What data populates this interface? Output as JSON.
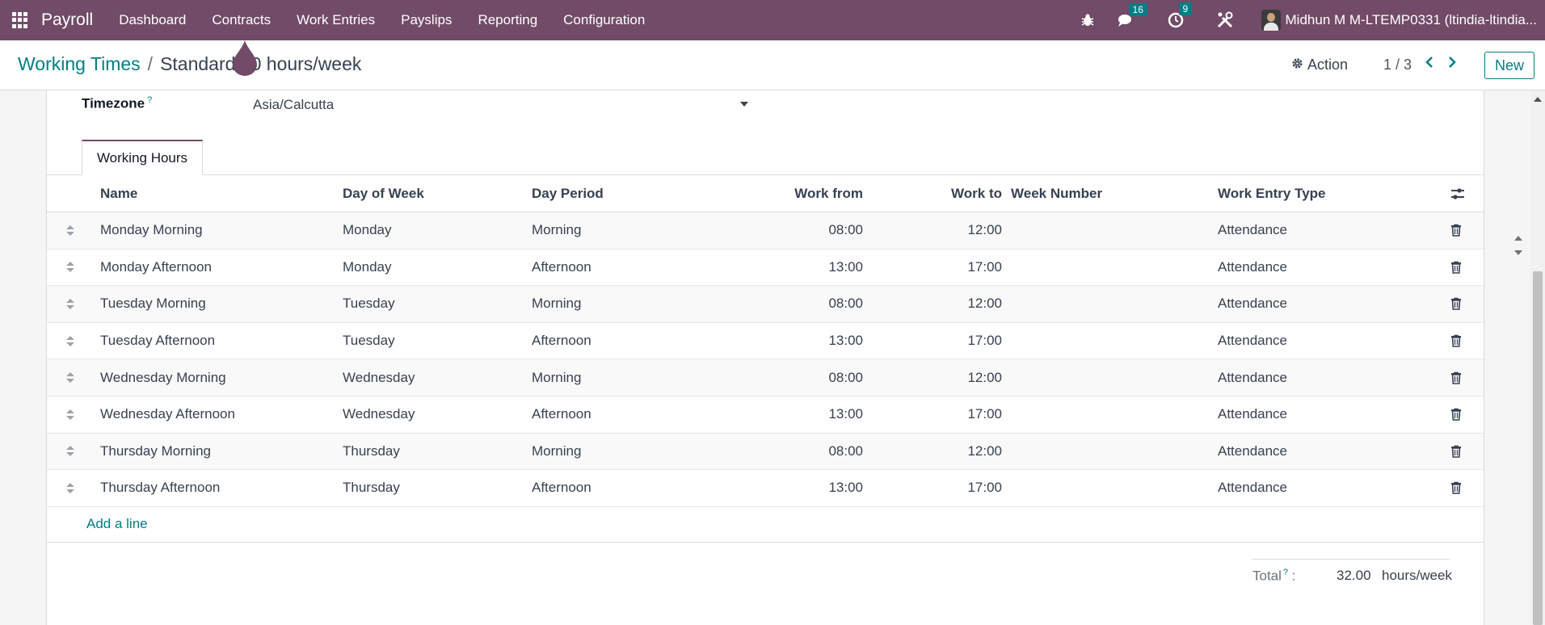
{
  "navbar": {
    "brand": "Payroll",
    "menu": [
      "Dashboard",
      "Contracts",
      "Work Entries",
      "Payslips",
      "Reporting",
      "Configuration"
    ],
    "messages_count": "16",
    "activities_count": "9",
    "user": "Midhun M M-LTEMP0331 (ltindia-ltindia..."
  },
  "breadcrumb": {
    "parent": "Working Times",
    "separator": "/",
    "current": "Standard 40 hours/week"
  },
  "control": {
    "action_label": "Action",
    "pager": "1 / 3",
    "new_label": "New"
  },
  "form": {
    "timezone_label": "Timezone",
    "help_mark": "?",
    "timezone_value": "Asia/Calcutta"
  },
  "tab": {
    "label": "Working Hours"
  },
  "table": {
    "headers": {
      "name": "Name",
      "day": "Day of Week",
      "period": "Day Period",
      "from": "Work from",
      "to": "Work to",
      "week": "Week Number",
      "type": "Work Entry Type"
    },
    "rows": [
      {
        "name": "Monday Morning",
        "day": "Monday",
        "period": "Morning",
        "from": "08:00",
        "to": "12:00",
        "week": "",
        "type": "Attendance"
      },
      {
        "name": "Monday Afternoon",
        "day": "Monday",
        "period": "Afternoon",
        "from": "13:00",
        "to": "17:00",
        "week": "",
        "type": "Attendance"
      },
      {
        "name": "Tuesday Morning",
        "day": "Tuesday",
        "period": "Morning",
        "from": "08:00",
        "to": "12:00",
        "week": "",
        "type": "Attendance"
      },
      {
        "name": "Tuesday Afternoon",
        "day": "Tuesday",
        "period": "Afternoon",
        "from": "13:00",
        "to": "17:00",
        "week": "",
        "type": "Attendance"
      },
      {
        "name": "Wednesday Morning",
        "day": "Wednesday",
        "period": "Morning",
        "from": "08:00",
        "to": "12:00",
        "week": "",
        "type": "Attendance"
      },
      {
        "name": "Wednesday Afternoon",
        "day": "Wednesday",
        "period": "Afternoon",
        "from": "13:00",
        "to": "17:00",
        "week": "",
        "type": "Attendance"
      },
      {
        "name": "Thursday Morning",
        "day": "Thursday",
        "period": "Morning",
        "from": "08:00",
        "to": "12:00",
        "week": "",
        "type": "Attendance"
      },
      {
        "name": "Thursday Afternoon",
        "day": "Thursday",
        "period": "Afternoon",
        "from": "13:00",
        "to": "17:00",
        "week": "",
        "type": "Attendance"
      }
    ],
    "add_line": "Add a line"
  },
  "total": {
    "label": "Total",
    "separator": ":",
    "value": "32.00",
    "unit": "hours/week"
  },
  "colors": {
    "brand": "#714b67",
    "accent": "#017e84"
  },
  "icons": [
    "apps-grid-icon",
    "bug-icon",
    "chat-icon",
    "clock-icon",
    "tools-icon",
    "gear-icon",
    "chevron-left-icon",
    "chevron-right-icon",
    "drag-handle-icon",
    "trash-icon",
    "column-settings-icon",
    "caret-down-icon"
  ]
}
